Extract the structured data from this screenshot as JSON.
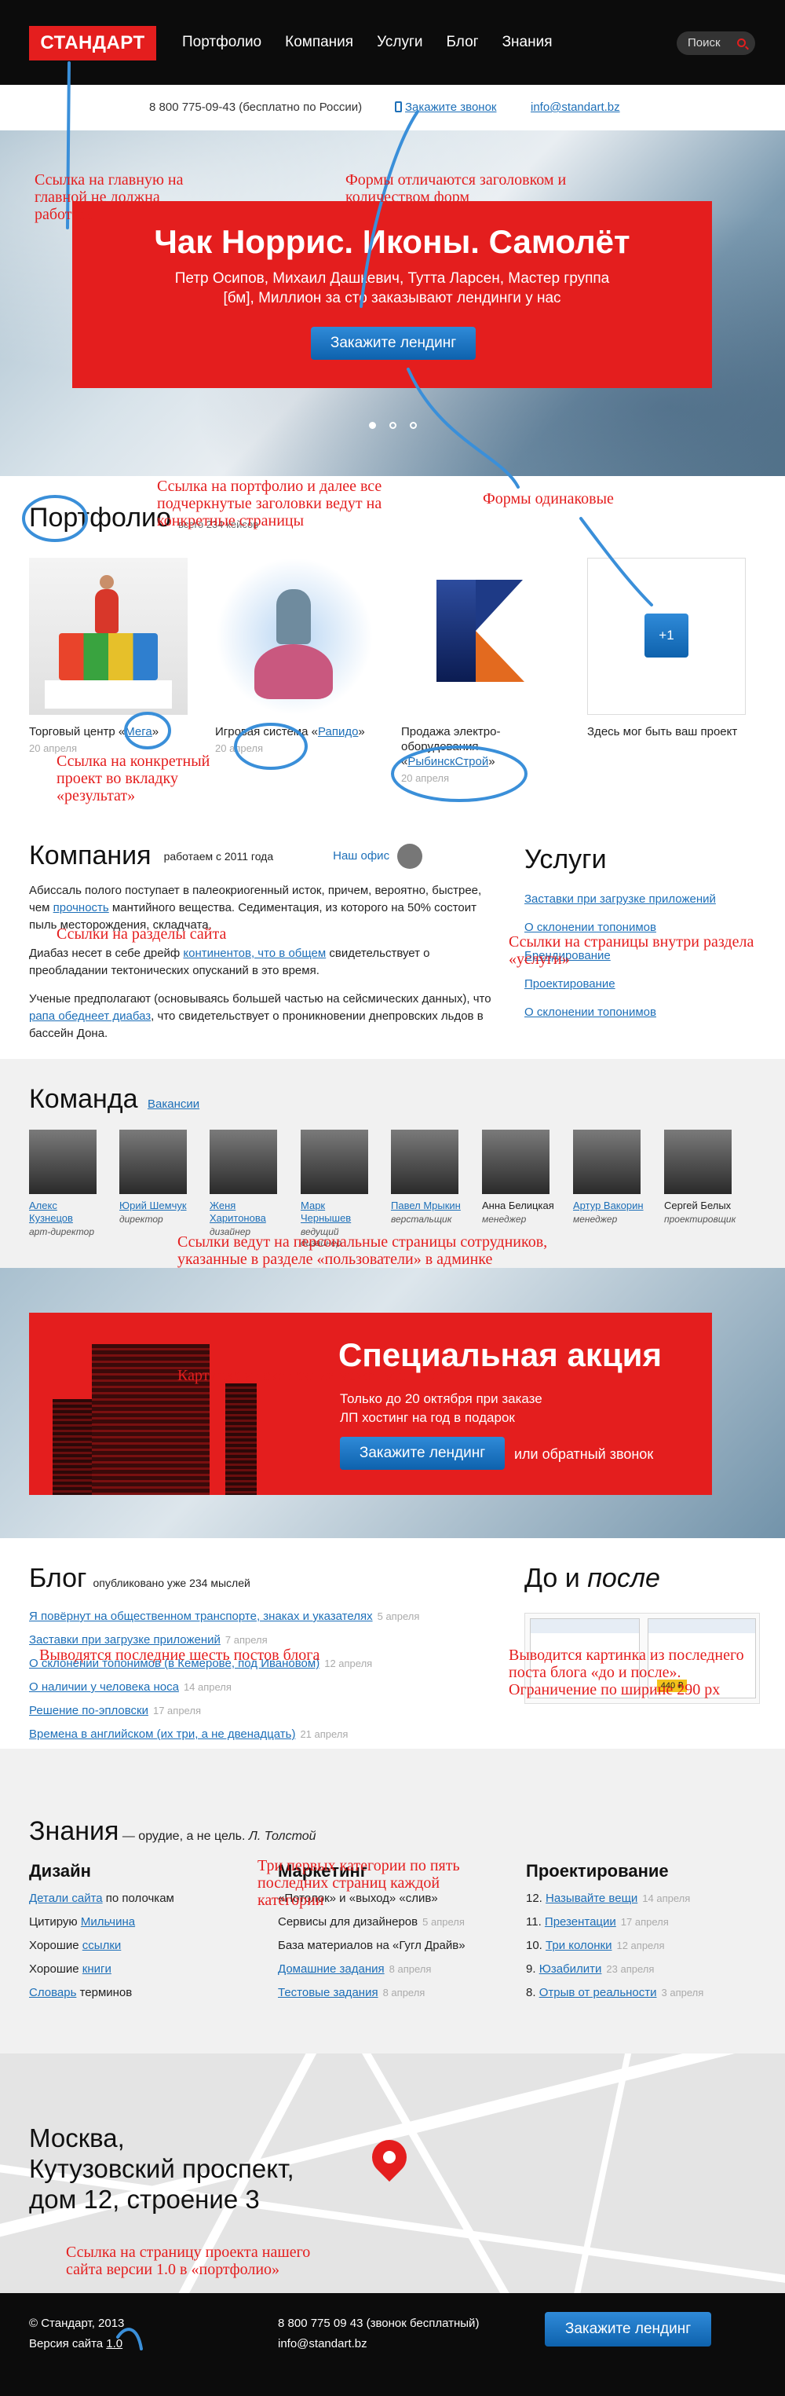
{
  "header": {
    "logo": "СТАНДАРТ",
    "nav": [
      "Портфолио",
      "Компания",
      "Услуги",
      "Блог",
      "Знания"
    ],
    "search_label": "Поиск"
  },
  "contacts": {
    "phone": "8 800 775-09-43 (бесплатно по России)",
    "callback": "Закажите звонок",
    "email": "info@standart.bz"
  },
  "hero": {
    "title": "Чак Норрис. Иконы. Самолёт",
    "text": "Петр Осипов, Михаил Дашкевич, Тутта Ларсен, Мастер группа [бм], Миллион за сто заказывают лендинги у нас",
    "button": "Закажите лендинг",
    "slides": 3,
    "active": 1
  },
  "portfolio": {
    "title": "Портфолио",
    "sub": "всего 234 кейсов",
    "items": [
      {
        "text_a": "Торговый центр «",
        "link": "Мега",
        "text_b": "»",
        "date": "20 апреля"
      },
      {
        "text_a": "Игровая система «",
        "link": "Рапидо",
        "text_b": "»",
        "date": "20 апреля"
      },
      {
        "text_a": "Продажа электро-оборудования «",
        "link": "РыбинскСтрой",
        "text_b": "»",
        "date": "20 апреля"
      },
      {
        "plus": "+1",
        "text": "Здесь мог быть ваш проект"
      }
    ]
  },
  "company": {
    "title": "Компания",
    "since": "работаем с 2011 года",
    "office": "Наш офис",
    "p1a": "Абиссаль полого поступает в палеокриогенный исток, причем, вероятно, быстрее, чем ",
    "p1l": "прочность",
    "p1b": " мантийного вещества. Седиментация, из которого на 50% состоит пыль месторождения, складчата.",
    "p2a": "Диабаз несет в себе дрейф ",
    "p2l": "континентов, что в общем",
    "p2b": " свидетельствует о преобладании тектонических опусканий в это время.",
    "p3a": "Ученые предполагают (основываясь большей частью на сейсмических данных), что ",
    "p3l": "рапа обеднеет диабаз",
    "p3b": ", что свидетельствует о проникновении днепровских льдов в бассейн Дона."
  },
  "services": {
    "title": "Услуги",
    "items": [
      "Заставки при загрузке приложений",
      "О склонении топонимов",
      "Брендирование",
      "Проектирование",
      "О склонении топонимов"
    ]
  },
  "team": {
    "title": "Команда",
    "vacancies": "Вакансии",
    "members": [
      {
        "name": "Алекс Кузнецов",
        "role": "арт-директор"
      },
      {
        "name": "Юрий Шемчук",
        "role": "директор"
      },
      {
        "name": "Женя Харитонова",
        "role": "дизайнер"
      },
      {
        "name": "Марк Чернышев",
        "role": "ведущий дизайнер"
      },
      {
        "name": "Павел Мрыкин",
        "role": "верстальщик"
      },
      {
        "name": "Анна Белицкая",
        "role": "менеджер"
      },
      {
        "name": "Артур Вакорин",
        "role": "менеджер"
      },
      {
        "name": "Сергей Белых",
        "role": "проектировщик"
      }
    ]
  },
  "promo": {
    "title": "Специальная акция",
    "line1": "Только до 20 октября при заказе",
    "line2": "ЛП хостинг на год в подарок",
    "button": "Закажите лендинг",
    "alt": "или обратный звонок"
  },
  "blog": {
    "title": "Блог",
    "sub": "опубликовано уже 234 мыслей",
    "posts": [
      {
        "t": "Я повёрнут на общественном транспорте, знаках и указателях",
        "d": "5 апреля"
      },
      {
        "t": "Заставки при загрузке приложений",
        "d": "7 апреля"
      },
      {
        "t": "О склонении топонимов (в Кемерове, под Ивановом)",
        "d": "12 апреля"
      },
      {
        "t": "О наличии у человека носа",
        "d": "14 апреля"
      },
      {
        "t": "Решение по-эпловски",
        "d": "17 апреля"
      },
      {
        "t": "Времена в английском (их три, а не двенадцать)",
        "d": "21 апреля"
      }
    ]
  },
  "before_after": {
    "title_a": "До и ",
    "title_b": "после",
    "price": "440 ₽"
  },
  "knowledge": {
    "title": "Знания",
    "motto": "— орудие, а не цель.",
    "author": "Л. Толстой",
    "design": {
      "title": "Дизайн",
      "items": [
        {
          "l": "Детали сайта",
          "a": " по полочкам"
        },
        {
          "a": "Цитирую ",
          "l": "Мильчина"
        },
        {
          "a": "Хорошие ",
          "l": "ссылки"
        },
        {
          "a": "Хорошие ",
          "l": "книги"
        },
        {
          "l": "Словарь",
          "a": " терминов"
        }
      ]
    },
    "mid": {
      "title": "Маркетинг",
      "items": [
        {
          "a": "«Потолок» и «выход» «слив»"
        },
        {
          "a": "Сервисы для дизайнеров",
          "d": "5 апреля"
        },
        {
          "a": "База материалов на «Гугл Драйв»"
        },
        {
          "l": "Домашние задания",
          "d": "8 апреля"
        },
        {
          "l": "Тестовые задания",
          "d": "8 апреля"
        }
      ]
    },
    "proj": {
      "title": "Проектирование",
      "items": [
        {
          "n": "12.",
          "l": "Называйте вещи",
          "d": "14 апреля"
        },
        {
          "n": "11.",
          "l": "Презентации",
          "d": "17 апреля"
        },
        {
          "n": "10.",
          "l": "Три колонки",
          "d": "12 апреля"
        },
        {
          "n": "9.",
          "l": "Юзабилити",
          "d": "23 апреля"
        },
        {
          "n": "8.",
          "l": "Отрыв от реальности",
          "d": "3 апреля"
        }
      ]
    }
  },
  "map": {
    "line1": "Москва,",
    "line2": "Кутузовский проспект,",
    "line3": "дом 12, строение 3"
  },
  "footer": {
    "copy": "© Стандарт, 2013",
    "ver_a": "Версия сайта ",
    "ver_l": "1.0",
    "phone": "8 800 775 09 43 (звонок бесплатный)",
    "email": "info@standart.bz",
    "button": "Закажите лендинг"
  },
  "annotations": {
    "a1": "Ссылка на главную на главной не должна работать",
    "a2": "Формы отличаются заголовком и количеством форм",
    "a3": "Ссылка на портфолио и далее все подчеркнутые заголовки ведут на конкретные страницы",
    "a4": "Формы одинаковые",
    "a5": "Ссылка на конкретный проект во вкладку «результат»",
    "a6": "Ссылки на разделы сайта",
    "a7": "Ссылки на страницы внутри раздела «услуги»",
    "a8": "Ссылки ведут на персональные страницы сотрудников, указанные в разделе «пользователи» в админке",
    "a9": "Картинка и текст акции может меняться",
    "a10": "Выводятся последние шесть постов блога",
    "a11": "Выводится картинка из последнего поста блога «до и после». Ограничение по ширине 290 px",
    "a12": "Три первых категории по пять последних страниц каждой категории",
    "a13": "Ссылка на страницу проекта нашего сайта версии 1.0 в «портфолио»"
  }
}
